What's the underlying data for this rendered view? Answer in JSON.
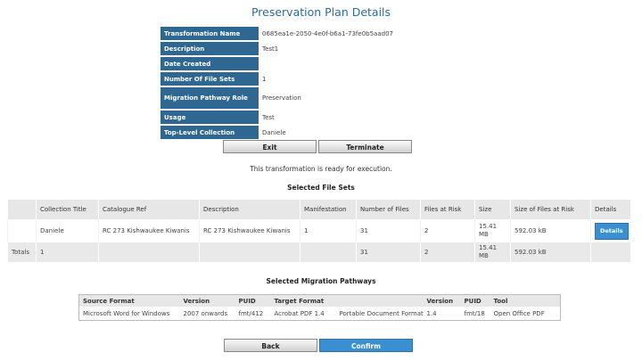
{
  "page_title": "Preservation Plan Details",
  "details": [
    {
      "label": "Transformation Name",
      "value": "0685ea1e-2050-4e0f-b6a1-73fe0b5aad07"
    },
    {
      "label": "Description",
      "value": "Test1"
    },
    {
      "label": "Date Created",
      "value": ""
    },
    {
      "label": "Number Of File Sets",
      "value": "1"
    },
    {
      "label": "Migration Pathway Role",
      "value": "Preservation"
    },
    {
      "label": "Usage",
      "value": "Test"
    },
    {
      "label": "Top-Level Collection",
      "value": "Daniele"
    }
  ],
  "buttons": {
    "exit": "Exit",
    "terminate": "Terminate",
    "back": "Back",
    "confirm": "Confirm"
  },
  "message": "This transformation is ready for execution.",
  "file_sets": {
    "title": "Selected File Sets",
    "headers": [
      "",
      "Collection Title",
      "Catalogue Ref",
      "Description",
      "Manifestation",
      "Number of Files",
      "Files at Risk",
      "Size",
      "Size of Files at Risk",
      "Details"
    ],
    "row": {
      "collection": "Daniele",
      "catalogue_ref": "RC 273 Kishwaukee Kiwanis",
      "description": "RC 273 Kishwaukee Kiwanis",
      "manifestation": "1",
      "num_files": "31",
      "files_at_risk": "2",
      "size": "15.41 MB",
      "size_at_risk": "592.03 kB",
      "details_label": "Details"
    },
    "totals": {
      "label": "Totals",
      "collection": "1",
      "num_files": "31",
      "files_at_risk": "2",
      "size": "15.41 MB",
      "size_at_risk": "592.03 kB"
    }
  },
  "pathways": {
    "title": "Selected Migration Pathways",
    "headers": [
      "Source Format",
      "Version",
      "PUID",
      "Target Format",
      "",
      "Version",
      "PUID",
      "Tool"
    ],
    "row": {
      "source_format": "Microsoft Word for Windows",
      "source_version": "2007 onwards",
      "source_puid": "fmt/412",
      "target_format": "Acrobat PDF 1.4",
      "target_format_desc": "Portable Document Format",
      "target_version": "1.4",
      "target_puid": "fmt/18",
      "tool": "Open Office PDF"
    }
  }
}
